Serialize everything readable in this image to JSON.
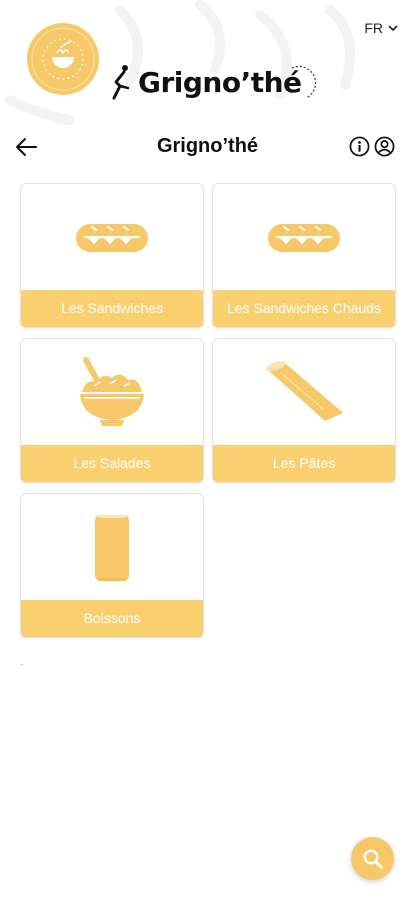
{
  "header": {
    "brand_name": "Grigno’thé",
    "language": "FR"
  },
  "navbar": {
    "title": "Grigno’thé"
  },
  "categories": [
    {
      "label": "Les Sandwiches",
      "icon": "sandwich-icon"
    },
    {
      "label": "Les Sandwiches Chauds",
      "icon": "sandwich-icon"
    },
    {
      "label": "Les Salades",
      "icon": "salad-bowl-icon"
    },
    {
      "label": "Les Pâtes",
      "icon": "penne-pasta-icon"
    },
    {
      "label": "Boissons",
      "icon": "drink-can-icon"
    }
  ],
  "colors": {
    "accent": "#f9cf70",
    "logo": "#f6c86a",
    "text": "#111111"
  }
}
